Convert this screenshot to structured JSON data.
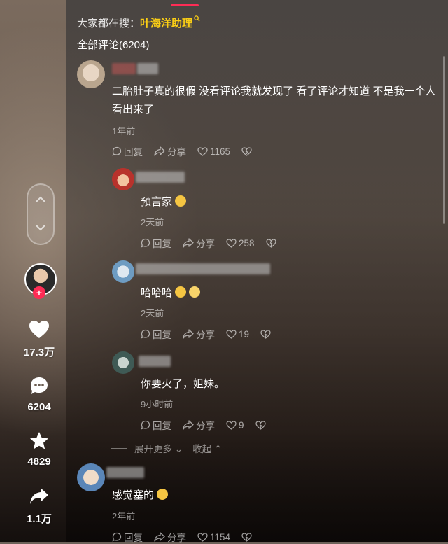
{
  "sidebar": {
    "likes": "17.3万",
    "comments": "6204",
    "favorites": "4829",
    "shares": "1.1万"
  },
  "search": {
    "prefix": "大家都在搜：",
    "keyword": "叶海洋助理"
  },
  "comments_header": "全部评论(6204)",
  "comments": [
    {
      "text": "二胎肚子真的很假 没看评论我就发现了 看了评论才知道 不是我一个人看出来了",
      "time": "1年前",
      "reply": "回复",
      "share": "分享",
      "likes": "1165"
    },
    {
      "text": "预言家",
      "time": "2天前",
      "reply": "回复",
      "share": "分享",
      "likes": "258"
    },
    {
      "text": "哈哈哈",
      "time": "2天前",
      "reply": "回复",
      "share": "分享",
      "likes": "19"
    },
    {
      "text": "你要火了，姐妹。",
      "time": "9小时前",
      "reply": "回复",
      "share": "分享",
      "likes": "9"
    },
    {
      "text": "感觉塞的",
      "time": "2年前",
      "reply": "回复",
      "share": "分享",
      "likes": "1154"
    }
  ],
  "expand": {
    "more": "展开更多",
    "collapse": "收起"
  },
  "colors": {
    "accent": "#fe2c55",
    "keyword": "#face15"
  }
}
